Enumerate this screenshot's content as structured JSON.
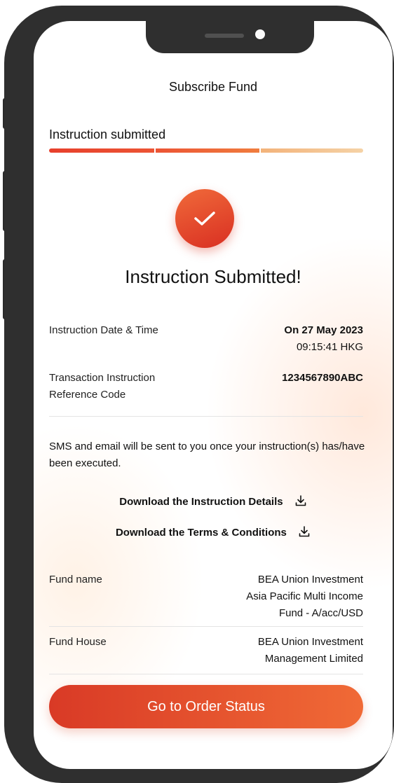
{
  "header": {
    "title": "Subscribe Fund"
  },
  "progress": {
    "step_label": "Instruction submitted",
    "completed_steps": 2,
    "total_steps": 3
  },
  "result": {
    "headline": "Instruction Submitted!"
  },
  "details": {
    "date_time": {
      "label": "Instruction Date & Time",
      "value_line1": "On 27 May 2023",
      "value_line2": "09:15:41 HKG"
    },
    "reference": {
      "label_line1": "Transaction Instruction",
      "label_line2": "Reference Code",
      "value": "1234567890ABC"
    }
  },
  "notice": "SMS and email will be sent to you once your instruction(s) has/have been executed.",
  "downloads": [
    {
      "label": "Download the Instruction Details",
      "icon": "download-icon"
    },
    {
      "label": "Download the Terms & Conditions",
      "icon": "download-icon"
    }
  ],
  "fund": {
    "name": {
      "label": "Fund name",
      "line1": "BEA Union Investment",
      "line2": "Asia Pacific Multi Income",
      "line3": "Fund - A/acc/USD"
    },
    "house": {
      "label": "Fund House",
      "line1": "BEA Union Investment",
      "line2": "Management Limited"
    }
  },
  "cta": {
    "label": "Go to Order Status"
  },
  "colors": {
    "accent": "#e5432c",
    "accent_light": "#f07d3e",
    "track_light": "#f5d2a6",
    "text": "#111111"
  }
}
